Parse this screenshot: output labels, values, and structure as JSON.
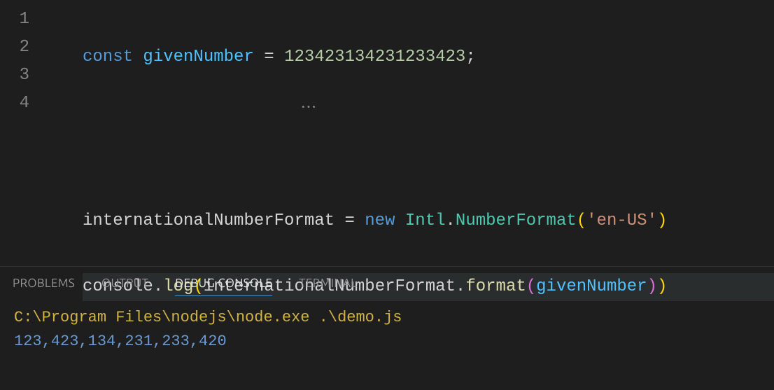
{
  "gutter": [
    "1",
    "2",
    "3",
    "4"
  ],
  "code": {
    "l1": {
      "const": "const",
      "sp": " ",
      "givenNumber": "givenNumber",
      "eq": " = ",
      "num": "123423134231233423",
      "semi": ";"
    },
    "l2": "",
    "l3": {
      "intl": "internationalNumberFormat",
      "eq": " = ",
      "new": "new",
      "sp": " ",
      "Intl": "Intl",
      "dot": ".",
      "NumberFormat": "NumberFormat",
      "lp": "(",
      "str": "'en-US'",
      "rp": ")"
    },
    "l4": {
      "console": "console",
      "dot1": ".",
      "log": "log",
      "lp1": "(",
      "inf": "internationalNumberFormat",
      "dot2": ".",
      "format": "format",
      "lp2": "(",
      "givenNumber": "givenNumber",
      "rp2": ")",
      "rp1": ")"
    }
  },
  "hint_dots": "•••",
  "tabs": {
    "problems": "PROBLEMS",
    "output": "OUTPUT",
    "debug": "DEBUG CONSOLE",
    "terminal": "TERMINAL"
  },
  "console": {
    "command": "C:\\Program Files\\nodejs\\node.exe .\\demo.js",
    "output": "123,423,134,231,233,420"
  }
}
